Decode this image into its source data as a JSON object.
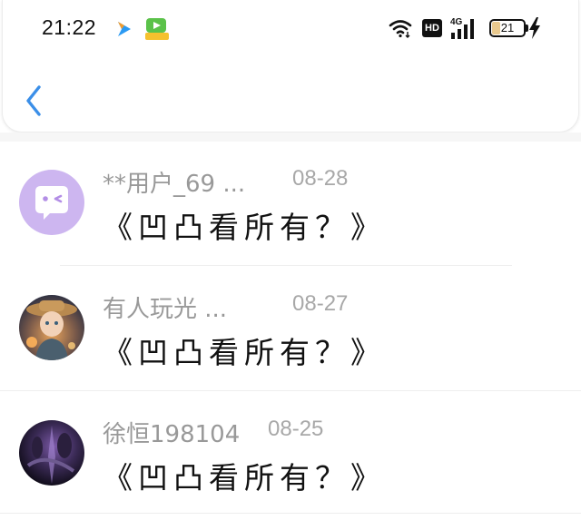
{
  "status_bar": {
    "time": "21:22",
    "network_badge": "HD",
    "network_type": "4G",
    "battery": "21"
  },
  "colors": {
    "accent": "#3b8fe8",
    "username_gray": "#999999",
    "date_gray": "#a8a8a8",
    "avatar_purple": "#cdb6f0"
  },
  "comments": [
    {
      "username": "**用户_69 ...",
      "date": "08-28",
      "text": "《凹凸看所有？》",
      "avatar_icon": "chat-bubble-face-icon"
    },
    {
      "username": "有人玩光 ...",
      "date": "08-27",
      "text": "《凹凸看所有？》",
      "avatar_icon": "character-photo"
    },
    {
      "username": "徐恒198104",
      "date": "08-25",
      "text": "《凹凸看所有？》",
      "avatar_icon": "dark-purple-photo"
    }
  ]
}
